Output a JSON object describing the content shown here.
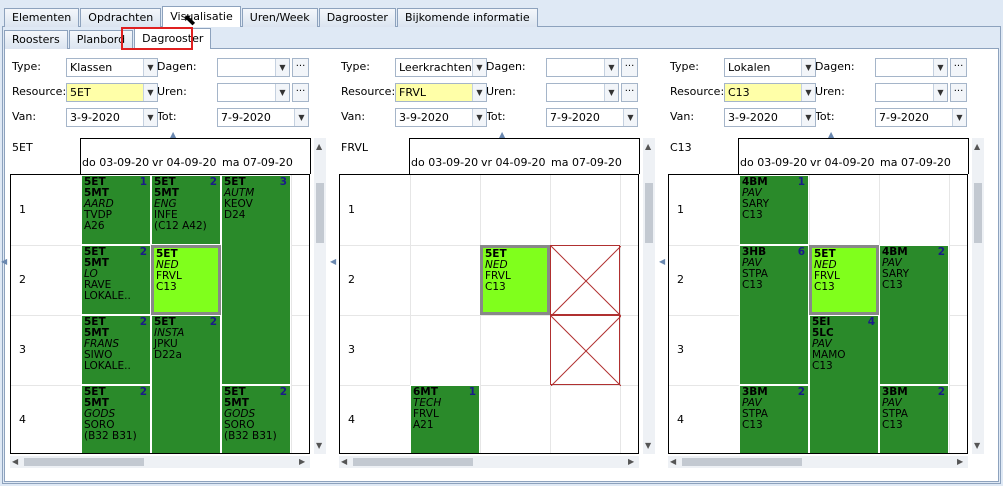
{
  "tabs_main": [
    "Elementen",
    "Opdrachten",
    "Visualisatie",
    "Uren/Week",
    "Dagrooster",
    "Bijkomende informatie"
  ],
  "tabs_sub": [
    "Roosters",
    "Planbord",
    "Dagrooster"
  ],
  "labels": {
    "type": "Type:",
    "resource": "Resource:",
    "van": "Van:",
    "dagen": "Dagen:",
    "uren": "Uren:",
    "tot": "Tot:",
    "dots": "···"
  },
  "panels": [
    {
      "type": "Klassen",
      "resource": "5ET",
      "van": "3-9-2020",
      "tot": "7-9-2020",
      "res_label": "5ET",
      "columns": [
        "do 03-09-20",
        "vr 04-09-20",
        "ma 07-09-20"
      ],
      "rows": [
        "1",
        "2",
        "3",
        "4"
      ],
      "lessons": [
        {
          "l1": "5ET",
          "n": "1",
          "lines": [
            "5MT"
          ],
          "it": "AARD",
          "rest": [
            "TVDP",
            "A26"
          ]
        },
        {
          "l1": "5ET",
          "n": "2",
          "lines": [
            "5MT"
          ],
          "it": "ENG",
          "rest": [
            "INFE",
            "(C12 A42)"
          ]
        },
        {
          "l1": "5ET",
          "n": "3",
          "lines": [],
          "it": "AUTM",
          "rest": [
            "KEOV",
            "D24"
          ]
        },
        {
          "l1": "5ET",
          "n": "2",
          "lines": [
            "5MT"
          ],
          "it": "LO",
          "rest": [
            "RAVE",
            "LOKALE.."
          ]
        },
        {
          "l1": "5ET",
          "n": "",
          "lines": [],
          "it": "NED",
          "rest": [
            "FRVL",
            "C13"
          ]
        },
        {
          "l1": "5ET",
          "n": "2",
          "lines": [
            "5MT"
          ],
          "it": "FRANS",
          "rest": [
            "SIWO",
            "LOKALE.."
          ]
        },
        {
          "l1": "5ET",
          "n": "2",
          "lines": [],
          "it": "INSTA",
          "rest": [
            "JPKU",
            "D22a"
          ]
        },
        {
          "l1": "5ET",
          "n": "2",
          "lines": [
            "5MT"
          ],
          "it": "GODS",
          "rest": [
            "SORO",
            "(B32 B31)"
          ]
        },
        {
          "l1": "5ET",
          "n": "2",
          "lines": [
            "5MT"
          ],
          "it": "GODS",
          "rest": [
            "SORO",
            "(B32 B31)"
          ]
        }
      ]
    },
    {
      "type": "Leerkrachten",
      "resource": "FRVL",
      "van": "3-9-2020",
      "tot": "7-9-2020",
      "res_label": "FRVL",
      "columns": [
        "do 03-09-20",
        "vr 04-09-20",
        "ma 07-09-20"
      ],
      "rows": [
        "1",
        "2",
        "3",
        "4"
      ],
      "lessons": [
        {
          "l1": "5ET",
          "n": "",
          "lines": [],
          "it": "NED",
          "rest": [
            "FRVL",
            "C13"
          ]
        },
        {
          "l1": "6MT",
          "n": "1",
          "lines": [],
          "it": "TECH",
          "rest": [
            "FRVL",
            "A21"
          ]
        }
      ]
    },
    {
      "type": "Lokalen",
      "resource": "C13",
      "van": "3-9-2020",
      "tot": "7-9-2020",
      "res_label": "C13",
      "columns": [
        "do 03-09-20",
        "vr 04-09-20",
        "ma 07-09-20"
      ],
      "rows": [
        "1",
        "2",
        "3",
        "4"
      ],
      "lessons": [
        {
          "l1": "4BM",
          "n": "1",
          "lines": [],
          "it": "PAV",
          "rest": [
            "SARY",
            "C13"
          ]
        },
        {
          "l1": "3HB",
          "n": "6",
          "lines": [],
          "it": "PAV",
          "rest": [
            "STPA",
            "C13"
          ]
        },
        {
          "l1": "5ET",
          "n": "",
          "lines": [],
          "it": "NED",
          "rest": [
            "FRVL",
            "C13"
          ]
        },
        {
          "l1": "4BM",
          "n": "2",
          "lines": [],
          "it": "PAV",
          "rest": [
            "SARY",
            "C13"
          ]
        },
        {
          "l1": "5EI",
          "n": "4",
          "lines": [
            "5LC"
          ],
          "it": "PAV",
          "rest": [
            "MAMO",
            "C13"
          ]
        },
        {
          "l1": "3BM",
          "n": "2",
          "lines": [],
          "it": "PAV",
          "rest": [
            "STPA",
            "C13"
          ]
        },
        {
          "l1": "3BM",
          "n": "2",
          "lines": [],
          "it": "PAV",
          "rest": [
            "STPA",
            "C13"
          ]
        }
      ]
    }
  ]
}
